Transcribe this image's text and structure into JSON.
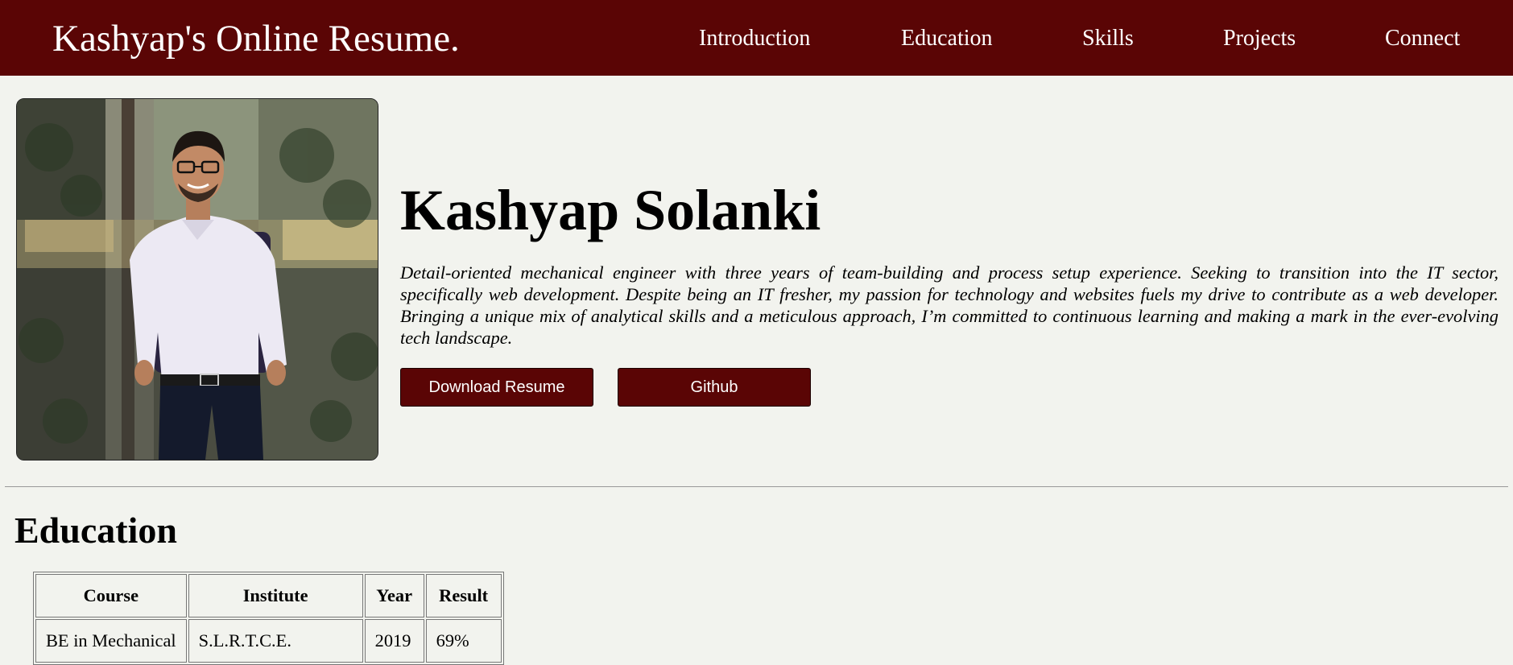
{
  "header": {
    "brand": "Kashyap's Online Resume.",
    "nav": [
      "Introduction",
      "Education",
      "Skills",
      "Projects",
      "Connect"
    ]
  },
  "intro": {
    "photo_alt": "Kashyap Solanki",
    "name": "Kashyap Solanki",
    "bio": "Detail-oriented mechanical engineer with three years of team-building and process setup experience. Seeking to transition into the IT sector, specifically web development. Despite being an IT fresher, my passion for technology and websites fuels my drive to contribute as a web developer. Bringing a unique mix of analytical skills and a meticulous approach, I’m committed to continuous learning and making a mark in the ever-evolving tech landscape.",
    "download_label": "Download Resume",
    "github_label": "Github"
  },
  "education": {
    "title": "Education",
    "headers": [
      "Course",
      "Institute",
      "Year",
      "Result"
    ],
    "rows": [
      [
        "BE in Mechanical",
        "S.L.R.T.C.E.",
        "2019",
        "69%"
      ]
    ]
  },
  "colors": {
    "accent": "#5a0505",
    "background": "#f2f3ee",
    "text": "#000000"
  }
}
